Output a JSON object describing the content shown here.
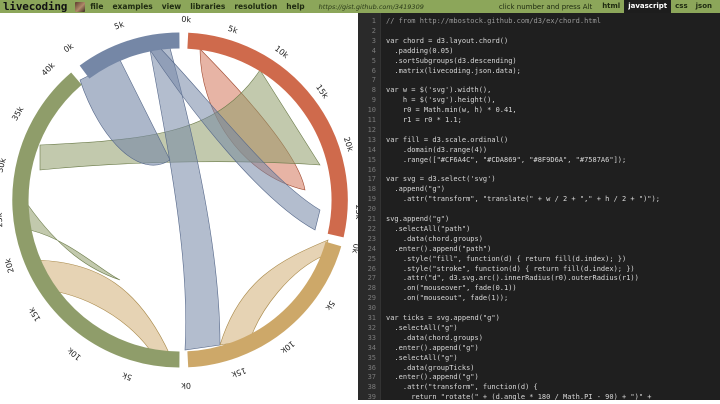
{
  "app": {
    "brand": "livecoding"
  },
  "menu": [
    "file",
    "examples",
    "view",
    "libraries",
    "resolution",
    "help"
  ],
  "gist_url": "https://gist.github.com/3419309",
  "hint": "click number and press Alt",
  "tabs": [
    {
      "label": "html",
      "active": false
    },
    {
      "label": "javascript",
      "active": true
    },
    {
      "label": "css",
      "active": false
    },
    {
      "label": "json",
      "active": false
    }
  ],
  "colors": {
    "topbar": "#8CA65A",
    "group0": "#CF6A4C",
    "group1": "#CDA869",
    "group2": "#8F9D6A",
    "group3": "#7587A6"
  },
  "chord_ticks": [
    "0k",
    "5k",
    "10k",
    "15k",
    "20k",
    "25k",
    "0k",
    "5k",
    "10k",
    "15k",
    "0k",
    "5k",
    "10k",
    "15k",
    "20k",
    "25k",
    "30k",
    "35k",
    "40k",
    "0k",
    "5k"
  ],
  "code_lines": [
    "// from http://mbostock.github.com/d3/ex/chord.html",
    "",
    "var chord = d3.layout.chord()",
    "  .padding(0.05)",
    "  .sortSubgroups(d3.descending)",
    "  .matrix(livecoding.json.data);",
    "",
    "var w = $('svg').width(),",
    "    h = $('svg').height(),",
    "    r0 = Math.min(w, h) * 0.41,",
    "    r1 = r0 * 1.1;",
    "",
    "var fill = d3.scale.ordinal()",
    "    .domain(d3.range(4))",
    "    .range([\"#CF6A4C\", \"#CDA869\", \"#8F9D6A\", \"#7587A6\"]);",
    "",
    "var svg = d3.select('svg')",
    "  .append(\"g\")",
    "    .attr(\"transform\", \"translate(\" + w / 2 + \",\" + h / 2 + \")\");",
    "",
    "svg.append(\"g\")",
    "  .selectAll(\"path\")",
    "    .data(chord.groups)",
    "  .enter().append(\"path\")",
    "    .style(\"fill\", function(d) { return fill(d.index); })",
    "    .style(\"stroke\", function(d) { return fill(d.index); })",
    "    .attr(\"d\", d3.svg.arc().innerRadius(r0).outerRadius(r1))",
    "    .on(\"mouseover\", fade(0.1))",
    "    .on(\"mouseout\", fade(1));",
    "",
    "var ticks = svg.append(\"g\")",
    "  .selectAll(\"g\")",
    "    .data(chord.groups)",
    "  .enter().append(\"g\")",
    "  .selectAll(\"g\")",
    "    .data(groupTicks)",
    "  .enter().append(\"g\")",
    "    .attr(\"transform\", function(d) {",
    "      return \"rotate(\" + (d.angle * 180 / Math.PI - 90) + \")\" +"
  ]
}
